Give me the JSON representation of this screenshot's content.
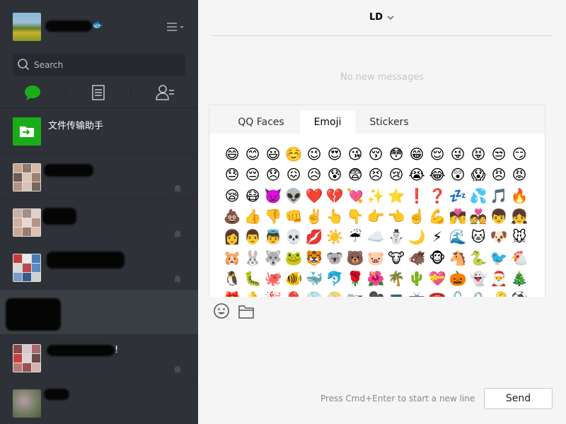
{
  "profile": {
    "fish_emoji": "🐟"
  },
  "search": {
    "placeholder": "Search"
  },
  "nav": {
    "chats_icon": "chat-bubble-icon",
    "contacts_icon": "contacts-list-icon",
    "people_icon": "add-person-icon"
  },
  "conversations": [
    {
      "title": "文件传输助手"
    },
    {
      "title": ""
    },
    {
      "title": ""
    },
    {
      "title": ""
    },
    {
      "title": ""
    },
    {
      "title": "!"
    },
    {
      "title": ""
    }
  ],
  "header": {
    "title": "LD"
  },
  "chat": {
    "empty_text": "No new messages"
  },
  "emoji_tabs": [
    "QQ Faces",
    "Emoji",
    "Stickers"
  ],
  "emoji_selected_tab": "Emoji",
  "emoji_rows": [
    [
      "😄",
      "😊",
      "😃",
      "☺️",
      "😉",
      "😍",
      "😘",
      "😚",
      "😳",
      "😁",
      "😌",
      "😜",
      "😝",
      "😒",
      "😏"
    ],
    [
      "😓",
      "😔",
      "😞",
      "😖",
      "😥",
      "😰",
      "😨",
      "😣",
      "😢",
      "😭",
      "😂",
      "😲",
      "😱",
      "😠",
      "😡"
    ],
    [
      "😪",
      "😷",
      "👿",
      "👽",
      "❤️",
      "💔",
      "💘",
      "✨",
      "⭐",
      "❗",
      "❓",
      "💤",
      "💦",
      "🎵",
      "🔥"
    ],
    [
      "💩",
      "👍",
      "👎",
      "👊",
      "✌️",
      "👆",
      "👇",
      "👉",
      "👈",
      "☝️",
      "💪",
      "💏",
      "💑",
      "👦",
      "👧"
    ],
    [
      "👩",
      "👨",
      "👼",
      "💀",
      "💋",
      "☀️",
      "☔",
      "☁️",
      "⛄",
      "🌙",
      "⚡",
      "🌊",
      "🐱",
      "🐶",
      "🐭"
    ],
    [
      "🐹",
      "🐰",
      "🐺",
      "🐸",
      "🐯",
      "🐨",
      "🐻",
      "🐷",
      "🐮",
      "🐗",
      "🐵",
      "🐴",
      "🐍",
      "🐦",
      "🐔"
    ],
    [
      "🐧",
      "🐛",
      "🐙",
      "🐠",
      "🐳",
      "🐬",
      "🌹",
      "🌺",
      "🌴",
      "🌵",
      "💝",
      "🎃",
      "👻",
      "🎅",
      "🎄"
    ],
    [
      "🎁",
      "🔔",
      "🎉",
      "🎈",
      "💿",
      "📀",
      "📷",
      "🎥",
      "💻",
      "📺",
      "☎️",
      "🔓",
      "🔒",
      "🔑",
      "⚽"
    ]
  ],
  "compose": {
    "smiley_icon": "smiley-icon",
    "folder_icon": "folder-icon",
    "hint": "Press Cmd+Enter to start a new line",
    "send_label": "Send"
  },
  "colors": {
    "sidebar": "#2e3238",
    "active_row": "#3a3f45",
    "wechat_green": "#1aad19"
  }
}
